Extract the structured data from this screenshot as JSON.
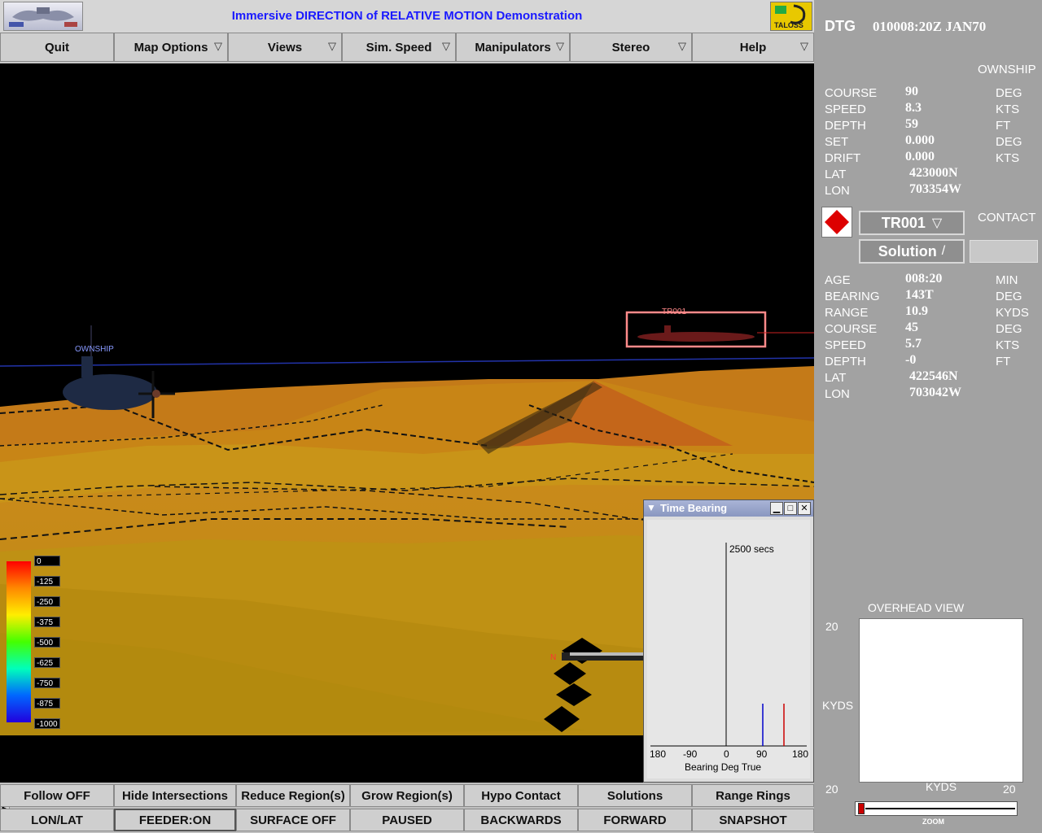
{
  "app_title": "Immersive DIRECTION of RELATIVE MOTION Demonstration",
  "logo_right_text": "TALOSS",
  "menu": [
    "Quit",
    "Map Options",
    "Views",
    "Sim. Speed",
    "Manipulators",
    "Stereo",
    "Help"
  ],
  "viewport": {
    "ownship_label": "OWNSHIP",
    "contact_label": "TR001",
    "legend": [
      "0",
      "-125",
      "-250",
      "-375",
      "-500",
      "-625",
      "-750",
      "-875",
      "-1000"
    ]
  },
  "time_bearing": {
    "title": "Time Bearing",
    "time_label": "2500 secs",
    "ticks": [
      "180",
      "-90",
      "0",
      "90",
      "180"
    ],
    "xlabel": "Bearing Deg True",
    "colors": {
      "blue": "#0000cc",
      "red": "#cc0000"
    }
  },
  "bottom_row1": [
    "Follow OFF",
    "Hide Intersections",
    "Reduce Region(s)",
    "Grow Region(s)",
    "Hypo Contact",
    "Solutions",
    "Range Rings"
  ],
  "bottom_row2": [
    "LON/LAT",
    "FEEDER:ON",
    "SURFACE OFF",
    "PAUSED",
    "BACKWARDS",
    "FORWARD",
    "SNAPSHOT"
  ],
  "panel": {
    "dtg_label": "DTG",
    "dtg_value": "010008:20Z JAN70",
    "ownship_header": "OWNSHIP",
    "ownship": [
      {
        "label": "COURSE",
        "value": "90",
        "unit": "DEG"
      },
      {
        "label": "SPEED",
        "value": "8.3",
        "unit": "KTS"
      },
      {
        "label": "DEPTH",
        "value": "59",
        "unit": "FT"
      },
      {
        "label": "SET",
        "value": "0.000",
        "unit": "DEG"
      },
      {
        "label": "DRIFT",
        "value": "0.000",
        "unit": "KTS"
      },
      {
        "label": "LAT",
        "value": "423000N",
        "unit": ""
      },
      {
        "label": "LON",
        "value": "703354W",
        "unit": ""
      }
    ],
    "contact_header": "CONTACT",
    "contact_select": "TR001",
    "solution_select": "Solution",
    "contact": [
      {
        "label": "AGE",
        "value": "008:20",
        "unit": "MIN"
      },
      {
        "label": "BEARING",
        "value": "143T",
        "unit": "DEG"
      },
      {
        "label": "RANGE",
        "value": "10.9",
        "unit": "KYDS"
      },
      {
        "label": "COURSE",
        "value": "45",
        "unit": "DEG"
      },
      {
        "label": "SPEED",
        "value": "5.7",
        "unit": "KTS"
      },
      {
        "label": "DEPTH",
        "value": "-0",
        "unit": "FT"
      },
      {
        "label": "LAT",
        "value": "422546N",
        "unit": ""
      },
      {
        "label": "LON",
        "value": "703042W",
        "unit": ""
      }
    ],
    "overhead_title": "OVERHEAD VIEW",
    "overhead_top_left": "20",
    "overhead_y_unit": "KYDS",
    "overhead_bottom_left": "20",
    "overhead_x_unit": "KYDS",
    "overhead_bottom_right": "20",
    "zoom_label": "ZOOM"
  }
}
